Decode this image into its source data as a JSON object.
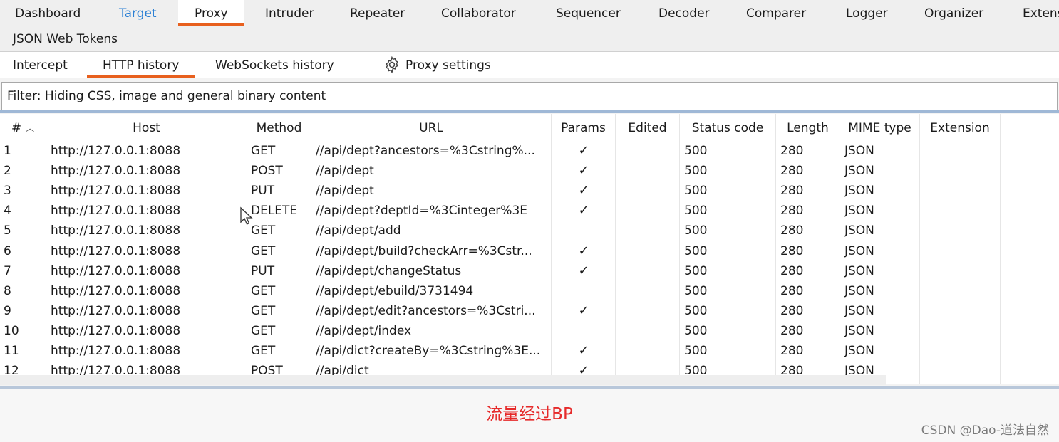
{
  "top_tabs_row1": [
    "Dashboard",
    "Target",
    "Proxy",
    "Intruder",
    "Repeater",
    "Collaborator",
    "Sequencer",
    "Decoder",
    "Comparer",
    "Logger",
    "Organizer",
    "Extens"
  ],
  "top_tabs_row2": [
    "JSON Web Tokens"
  ],
  "active_top_tab": "Proxy",
  "sub_tabs": [
    "Intercept",
    "HTTP history",
    "WebSockets history"
  ],
  "active_sub_tab": "HTTP history",
  "proxy_settings_label": "Proxy settings",
  "filter_text": "Filter: Hiding CSS, image and general binary content",
  "columns": [
    "#",
    "Host",
    "Method",
    "URL",
    "Params",
    "Edited",
    "Status code",
    "Length",
    "MIME type",
    "Extension"
  ],
  "rows": [
    {
      "num": "1",
      "host": "http://127.0.0.1:8088",
      "method": "GET",
      "url": "//api/dept?ancestors=%3Cstring%...",
      "params": "✓",
      "edited": "",
      "status": "500",
      "length": "280",
      "mime": "JSON",
      "ext": ""
    },
    {
      "num": "2",
      "host": "http://127.0.0.1:8088",
      "method": "POST",
      "url": "//api/dept",
      "params": "✓",
      "edited": "",
      "status": "500",
      "length": "280",
      "mime": "JSON",
      "ext": ""
    },
    {
      "num": "3",
      "host": "http://127.0.0.1:8088",
      "method": "PUT",
      "url": "//api/dept",
      "params": "✓",
      "edited": "",
      "status": "500",
      "length": "280",
      "mime": "JSON",
      "ext": ""
    },
    {
      "num": "4",
      "host": "http://127.0.0.1:8088",
      "method": "DELETE",
      "url": "//api/dept?deptId=%3Cinteger%3E",
      "params": "✓",
      "edited": "",
      "status": "500",
      "length": "280",
      "mime": "JSON",
      "ext": ""
    },
    {
      "num": "5",
      "host": "http://127.0.0.1:8088",
      "method": "GET",
      "url": "//api/dept/add",
      "params": "",
      "edited": "",
      "status": "500",
      "length": "280",
      "mime": "JSON",
      "ext": ""
    },
    {
      "num": "6",
      "host": "http://127.0.0.1:8088",
      "method": "GET",
      "url": "//api/dept/build?checkArr=%3Cstr...",
      "params": "✓",
      "edited": "",
      "status": "500",
      "length": "280",
      "mime": "JSON",
      "ext": ""
    },
    {
      "num": "7",
      "host": "http://127.0.0.1:8088",
      "method": "PUT",
      "url": "//api/dept/changeStatus",
      "params": "✓",
      "edited": "",
      "status": "500",
      "length": "280",
      "mime": "JSON",
      "ext": ""
    },
    {
      "num": "8",
      "host": "http://127.0.0.1:8088",
      "method": "GET",
      "url": "//api/dept/ebuild/3731494",
      "params": "",
      "edited": "",
      "status": "500",
      "length": "280",
      "mime": "JSON",
      "ext": ""
    },
    {
      "num": "9",
      "host": "http://127.0.0.1:8088",
      "method": "GET",
      "url": "//api/dept/edit?ancestors=%3Cstri...",
      "params": "✓",
      "edited": "",
      "status": "500",
      "length": "280",
      "mime": "JSON",
      "ext": ""
    },
    {
      "num": "10",
      "host": "http://127.0.0.1:8088",
      "method": "GET",
      "url": "//api/dept/index",
      "params": "",
      "edited": "",
      "status": "500",
      "length": "280",
      "mime": "JSON",
      "ext": ""
    },
    {
      "num": "11",
      "host": "http://127.0.0.1:8088",
      "method": "GET",
      "url": "//api/dict?createBy=%3Cstring%3E...",
      "params": "✓",
      "edited": "",
      "status": "500",
      "length": "280",
      "mime": "JSON",
      "ext": ""
    },
    {
      "num": "12",
      "host": "http://127.0.0.1:8088",
      "method": "POST",
      "url": "//api/dict",
      "params": "✓",
      "edited": "",
      "status": "500",
      "length": "280",
      "mime": "JSON",
      "ext": ""
    }
  ],
  "caption": "流量经过BP",
  "watermark": "CSDN @Dao-道法自然",
  "colors": {
    "accent": "#e8601e",
    "target_blue": "#2a7fd4",
    "caption_red": "#e62a2a"
  }
}
